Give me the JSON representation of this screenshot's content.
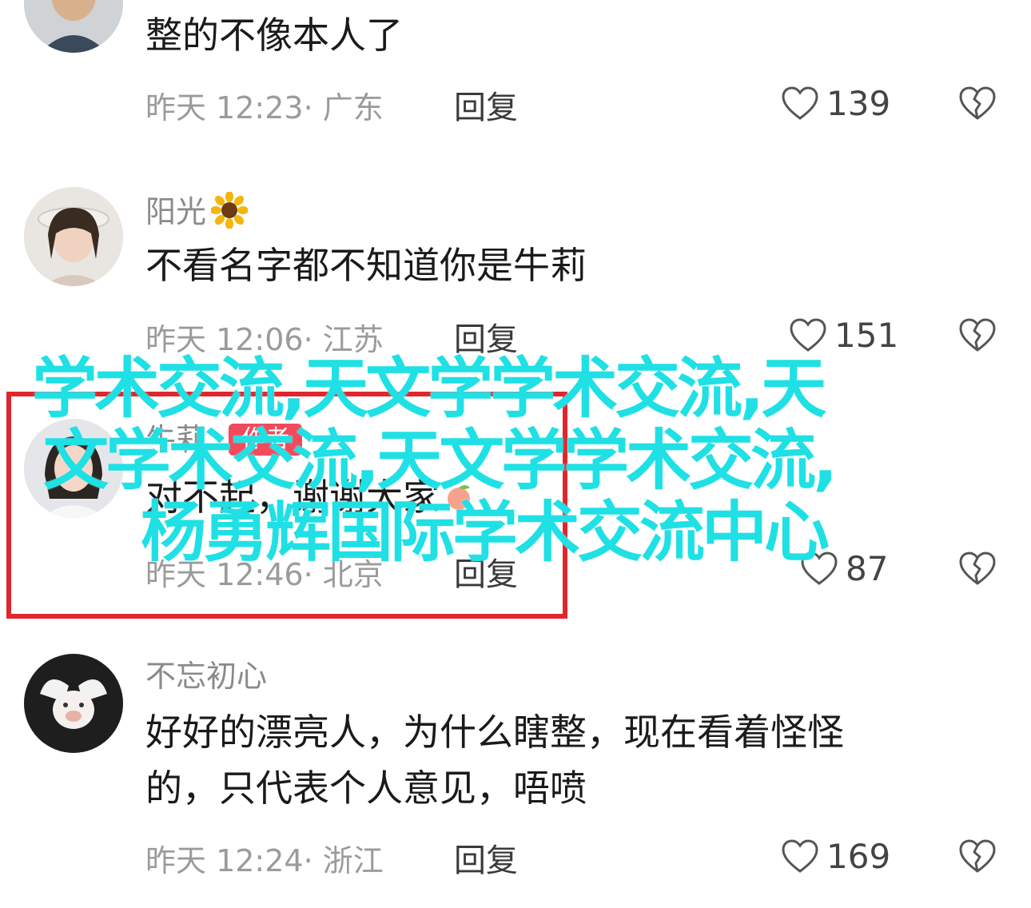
{
  "comments": [
    {
      "username": "",
      "text_lines": [
        "整的不像本人了"
      ],
      "time": "昨天 12:23· 广东",
      "reply": "回复",
      "likes": "139"
    },
    {
      "username": "阳光",
      "text_lines": [
        "不看名字都不知道你是牛莉"
      ],
      "time": "昨天 12:06· 江苏",
      "reply": "回复",
      "likes": "151"
    },
    {
      "username": "牛莉",
      "badge": "作者",
      "text_lines": [
        "对不起，谢谢大家"
      ],
      "time": "昨天 12:46· 北京",
      "reply": "回复",
      "likes": "87"
    },
    {
      "username": "不忘初心",
      "text_lines": [
        "好好的漂亮人，为什么瞎整，现在看着怪怪",
        "的，只代表个人意见，唔喷"
      ],
      "time": "昨天 12:24· 浙江",
      "reply": "回复",
      "likes": "169"
    }
  ],
  "overlay": {
    "line1": "学术交流,天文学学术交流,天",
    "line2": "文学术交流,天文学学术交流,",
    "line3": "杨勇辉国际学术交流中心"
  },
  "colors": {
    "highlight_border": "#e0262d",
    "overlay_text": "#1fe0e4",
    "author_badge": "#f04a5c"
  }
}
